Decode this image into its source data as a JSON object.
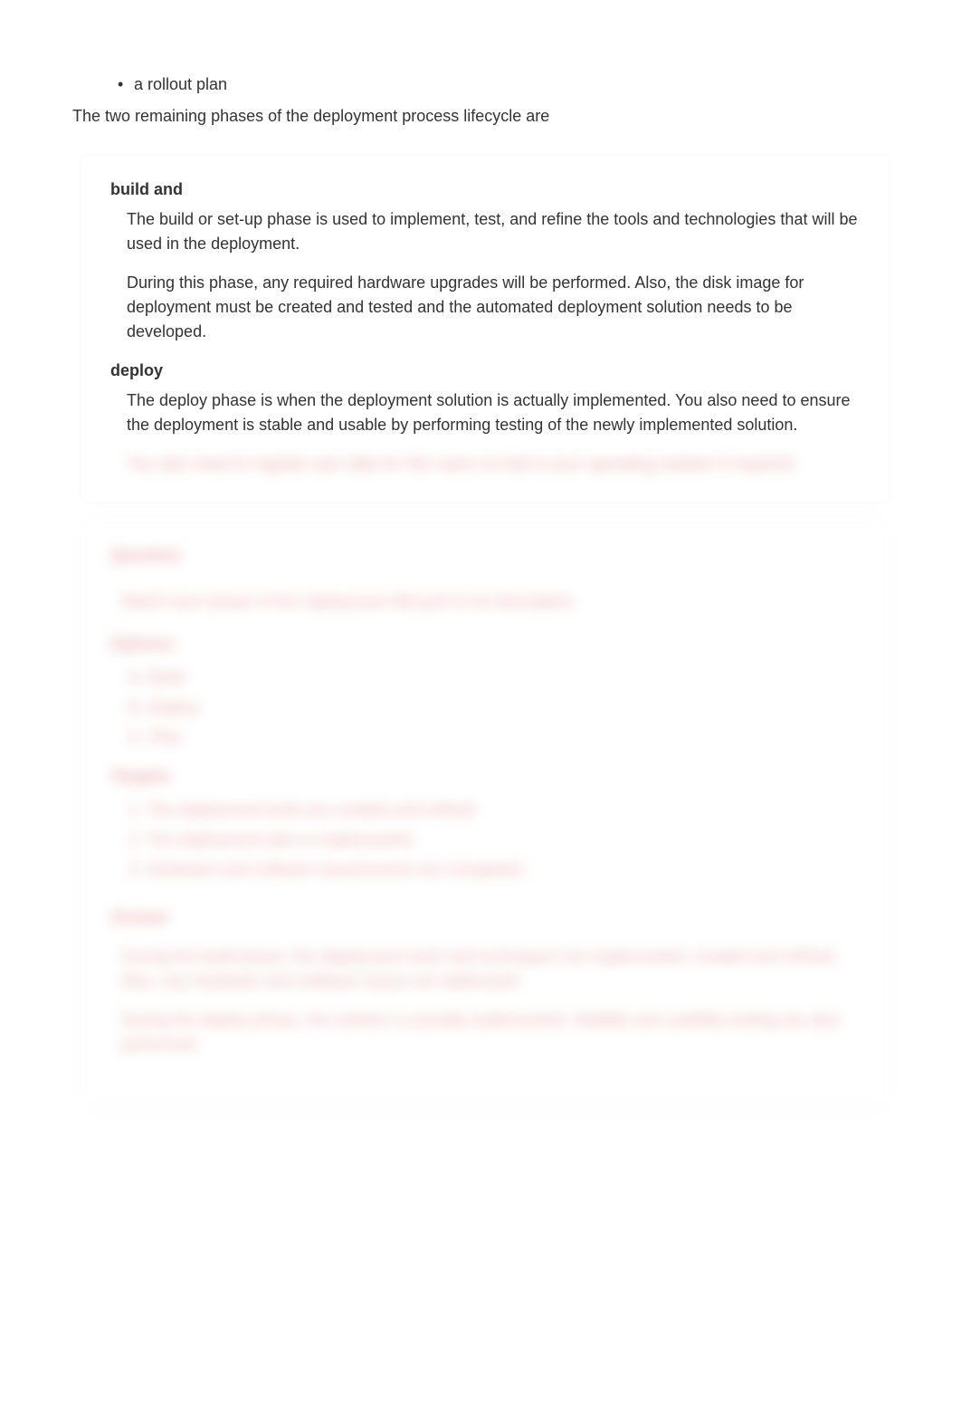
{
  "bulletItem": "a rollout plan",
  "intro": "The two remaining phases of the deployment process lifecycle are",
  "phases": {
    "buildTitle": "build and",
    "buildP1": "The build or set-up phase is used to implement, test, and refine the tools and technologies that will be used in the deployment.",
    "buildP2": "During this phase, any required hardware upgrades will be performed. Also, the disk image for deployment must be created and tested and the automated deployment solution needs to be developed.",
    "deployTitle": "deploy",
    "deployP1": "The deploy phase is when the deployment solution is actually implemented. You also need to ensure the deployment is stable and usable by performing testing of the newly implemented solution.",
    "deployBlurred": "You also need to migrate user data for this users so that is your operating solution if required."
  },
  "question": {
    "heading": "Question",
    "prompt": "Match each phase of the deployment lifecycle to its description.",
    "optionsLabel": "Options:",
    "options": {
      "a": "A. Build",
      "b": "B. Deploy",
      "c": "C. Plan"
    },
    "targetsLabel": "Targets:",
    "targets": {
      "t1": "1. The deployment tools are created and refined",
      "t2": "2. The deployment plan is implemented",
      "t3": "3. Hardware and software assessments are completed"
    },
    "answerHeading": "Answer",
    "answerP1": "During the build phase, the deployment tools and techniques are implemented, created and refined. Also, any hardware and software issues are addressed.",
    "answerP2": "During the deploy phase, the solution is actually implemented. Stability and usability testing are also performed."
  }
}
